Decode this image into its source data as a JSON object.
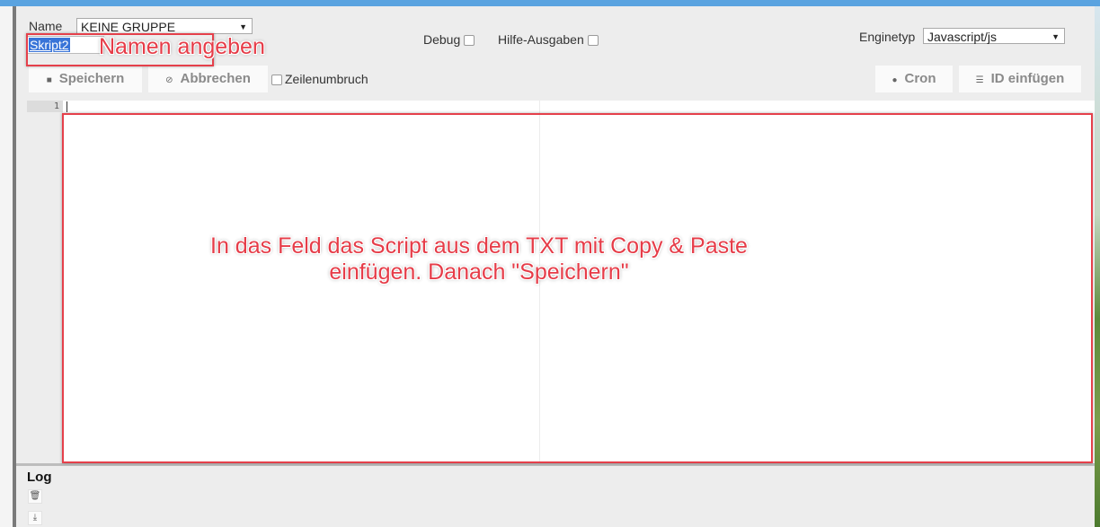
{
  "header": {
    "name_label": "Name",
    "group_select": "KEINE GRUPPE",
    "name_value": "Skript2",
    "debug_label": "Debug",
    "hilfe_label": "Hilfe-Ausgaben",
    "engine_label": "Enginetyp",
    "engine_select": "Javascript/js"
  },
  "toolbar": {
    "save_label": "Speichern",
    "cancel_label": "Abbrechen",
    "wrap_label": "Zeilenumbruch",
    "cron_label": "Cron",
    "insert_id_label": "ID einfügen"
  },
  "editor": {
    "line_numbers": [
      "1"
    ]
  },
  "annotations": {
    "name_hint": "Namen angeben",
    "editor_hint_line1": "In das Feld das Script aus dem TXT mit Copy & Paste",
    "editor_hint_line2": "einfügen. Danach \"Speichern\""
  },
  "log": {
    "title": "Log"
  },
  "colors": {
    "accent": "#5aa3e0",
    "annotation": "#e5404b",
    "selection": "#3874d8"
  },
  "icons": {
    "select_arrow": "chevron-down-icon",
    "save": "floppy-icon",
    "cancel": "cancel-icon",
    "cron": "clock-icon",
    "insert_id": "list-icon",
    "log_delete": "trash-icon",
    "log_download": "download-icon"
  }
}
